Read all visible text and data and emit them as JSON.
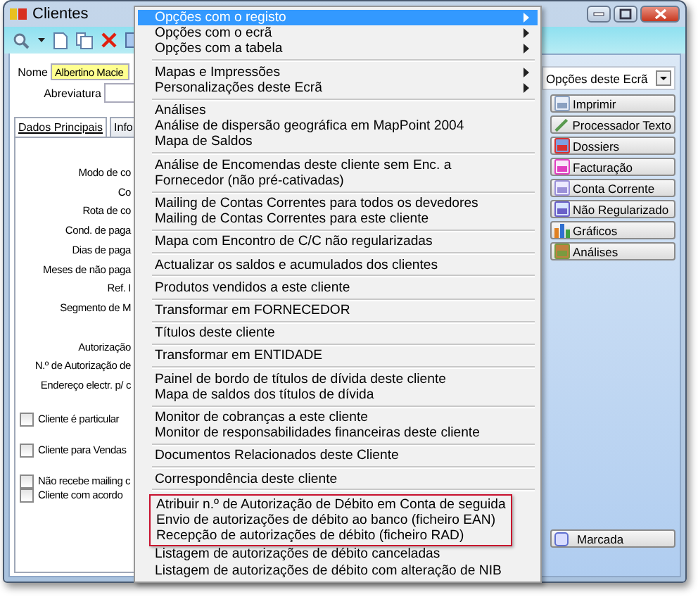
{
  "window": {
    "title": "Clientes"
  },
  "form": {
    "name_label": "Nome",
    "name_value": "Albertino Macie",
    "abbrev_label": "Abreviatura"
  },
  "tabs": [
    {
      "label": "Dados Principais",
      "selected": true
    },
    {
      "label": "Info",
      "selected": false
    }
  ],
  "label_groups": [
    [
      "Modo de co",
      "Co",
      "Rota de co",
      "Cond. de paga",
      "Dias de paga",
      "Meses de não paga",
      "Ref. I",
      "Segmento de M"
    ],
    [
      "Autorização",
      "N.º de Autorização de",
      "Endereço electr. p/ c"
    ]
  ],
  "checkbox_groups": [
    [
      {
        "label": "Cliente é particular",
        "checked": false
      }
    ],
    [
      {
        "label": "Cliente para Vendas",
        "checked": false
      }
    ],
    [
      {
        "label": "Não recebe mailing c",
        "checked": false
      },
      {
        "label": "Cliente com acordo",
        "checked": false
      }
    ]
  ],
  "menu": [
    {
      "kind": "item",
      "label": "Opções com o registo",
      "submenu": true,
      "selected": true
    },
    {
      "kind": "item",
      "label": "Opções com o ecrã",
      "submenu": true,
      "selected": false
    },
    {
      "kind": "item",
      "label": "Opções com a tabela",
      "submenu": true,
      "selected": false
    },
    {
      "kind": "separator"
    },
    {
      "kind": "item",
      "label": "Mapas e Impressões",
      "submenu": true,
      "selected": false
    },
    {
      "kind": "item",
      "label": "Personalizações deste Ecrã",
      "submenu": true,
      "selected": false
    },
    {
      "kind": "separator"
    },
    {
      "kind": "item",
      "label": "Análises",
      "submenu": false,
      "selected": false
    },
    {
      "kind": "item",
      "label": "Análise de dispersão geográfica em MapPoint 2004",
      "submenu": false,
      "selected": false
    },
    {
      "kind": "item",
      "label": "Mapa de Saldos",
      "submenu": false,
      "selected": false
    },
    {
      "kind": "separator"
    },
    {
      "kind": "item",
      "label": "Análise de Encomendas deste cliente sem Enc. a Fornecedor (não pré-cativadas)",
      "submenu": false,
      "selected": false
    },
    {
      "kind": "separator"
    },
    {
      "kind": "item",
      "label": "Mailing de Contas Correntes para todos os devedores",
      "submenu": false,
      "selected": false
    },
    {
      "kind": "item",
      "label": "Mailing de Contas Correntes para este cliente",
      "submenu": false,
      "selected": false
    },
    {
      "kind": "separator"
    },
    {
      "kind": "item",
      "label": "Mapa com Encontro de C/C não regularizadas",
      "submenu": false,
      "selected": false
    },
    {
      "kind": "separator"
    },
    {
      "kind": "item",
      "label": "Actualizar os saldos e acumulados dos clientes",
      "submenu": false,
      "selected": false
    },
    {
      "kind": "separator"
    },
    {
      "kind": "item",
      "label": "Produtos vendidos a este cliente",
      "submenu": false,
      "selected": false
    },
    {
      "kind": "separator"
    },
    {
      "kind": "item",
      "label": "Transformar em FORNECEDOR",
      "submenu": false,
      "selected": false
    },
    {
      "kind": "separator"
    },
    {
      "kind": "item",
      "label": "Títulos deste cliente",
      "submenu": false,
      "selected": false
    },
    {
      "kind": "separator"
    },
    {
      "kind": "item",
      "label": "Transformar em ENTIDADE",
      "submenu": false,
      "selected": false
    },
    {
      "kind": "separator"
    },
    {
      "kind": "item",
      "label": "Painel de bordo de títulos de dívida deste cliente",
      "submenu": false,
      "selected": false
    },
    {
      "kind": "item",
      "label": "Mapa de saldos dos títulos de dívida",
      "submenu": false,
      "selected": false
    },
    {
      "kind": "separator"
    },
    {
      "kind": "item",
      "label": "Monitor de cobranças a este cliente",
      "submenu": false,
      "selected": false
    },
    {
      "kind": "item",
      "label": "Monitor de responsabilidades financeiras deste cliente",
      "submenu": false,
      "selected": false
    },
    {
      "kind": "separator"
    },
    {
      "kind": "item",
      "label": "Documentos Relacionados deste Cliente",
      "submenu": false,
      "selected": false
    },
    {
      "kind": "separator"
    },
    {
      "kind": "item",
      "label": "Correspondência deste cliente",
      "submenu": false,
      "selected": false
    },
    {
      "kind": "separator"
    },
    {
      "kind": "box",
      "items": [
        {
          "label": "Atribuir n.º de Autorização de Débito em Conta de seguida",
          "selected": false
        },
        {
          "label": "Envio de autorizações de débito ao banco (ficheiro EAN)",
          "selected": false
        },
        {
          "label": "Recepção de autorizações de débito (ficheiro RAD)",
          "selected": false
        }
      ]
    },
    {
      "kind": "item",
      "label": "Listagem de autorizações de débito canceladas",
      "submenu": false,
      "selected": false
    },
    {
      "kind": "item",
      "label": "Listagem de autorizações de débito com alteração de NIB",
      "submenu": false,
      "selected": false
    }
  ],
  "side_panel": {
    "dropdown": "Opções deste Ecrã",
    "buttons": [
      "Imprimir",
      "Processador Texto",
      "Dossiers",
      "Facturação",
      "Conta Corrente",
      "Não Regularizado",
      "Gráficos",
      "Análises"
    ],
    "marked_button": "Marcada"
  }
}
